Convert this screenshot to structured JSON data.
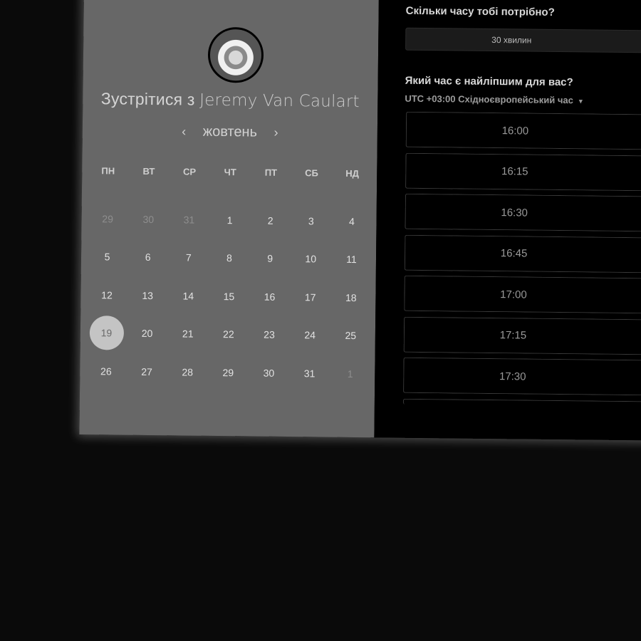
{
  "host": {
    "meet_prefix": "Зустрітися з",
    "name": "Jeremy Van Caulart"
  },
  "calendar": {
    "month": "жовтень",
    "prev_icon": "chevron-left-icon",
    "next_icon": "chevron-right-icon",
    "weekdays": [
      "ПН",
      "ВТ",
      "СР",
      "ЧТ",
      "ПТ",
      "СБ",
      "НД"
    ],
    "weeks": [
      [
        {
          "d": "29",
          "m": true
        },
        {
          "d": "30",
          "m": true
        },
        {
          "d": "31",
          "m": true
        },
        {
          "d": "1"
        },
        {
          "d": "2"
        },
        {
          "d": "3"
        },
        {
          "d": "4"
        }
      ],
      [
        {
          "d": "5"
        },
        {
          "d": "6"
        },
        {
          "d": "7"
        },
        {
          "d": "8"
        },
        {
          "d": "9"
        },
        {
          "d": "10"
        },
        {
          "d": "11"
        }
      ],
      [
        {
          "d": "12"
        },
        {
          "d": "13"
        },
        {
          "d": "14"
        },
        {
          "d": "15"
        },
        {
          "d": "16"
        },
        {
          "d": "17"
        },
        {
          "d": "18"
        }
      ],
      [
        {
          "d": "19",
          "s": true
        },
        {
          "d": "20"
        },
        {
          "d": "21"
        },
        {
          "d": "22"
        },
        {
          "d": "23"
        },
        {
          "d": "24"
        },
        {
          "d": "25"
        }
      ],
      [
        {
          "d": "26"
        },
        {
          "d": "27"
        },
        {
          "d": "28"
        },
        {
          "d": "29"
        },
        {
          "d": "30"
        },
        {
          "d": "31"
        },
        {
          "d": "1",
          "m": true
        }
      ]
    ]
  },
  "duration": {
    "question": "Скільки часу тобі потрібно?",
    "value": "30 хвилин"
  },
  "times": {
    "question": "Який час є найліпшим для вас?",
    "timezone": "UTC +03:00 Східноєвропейський час",
    "slots": [
      "16:00",
      "16:15",
      "16:30",
      "16:45",
      "17:00",
      "17:15",
      "17:30"
    ]
  },
  "colors": {
    "left_panel": "#676767",
    "right_panel": "#000000",
    "selected_day": "#c4c4c4"
  }
}
